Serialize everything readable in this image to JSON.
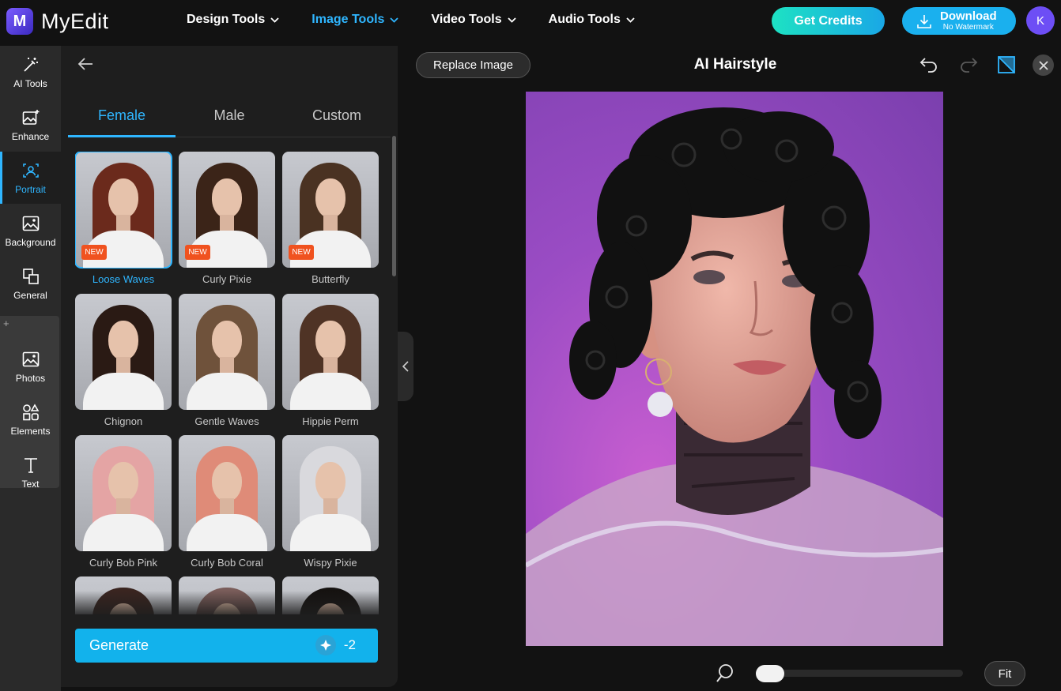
{
  "app": {
    "logo_letter": "M",
    "name": "MyEdit"
  },
  "nav": [
    {
      "label": "Design Tools"
    },
    {
      "label": "Image Tools"
    },
    {
      "label": "Video Tools"
    },
    {
      "label": "Audio Tools"
    }
  ],
  "header": {
    "credits_label": "Get Credits",
    "download_label": "Download",
    "download_sub": "No Watermark",
    "avatar_initial": "K"
  },
  "rail": [
    {
      "label": "AI Tools",
      "icon": "magic-wand-icon"
    },
    {
      "label": "Enhance",
      "icon": "enhance-image-icon"
    },
    {
      "label": "Portrait",
      "icon": "portrait-icon"
    },
    {
      "label": "Background",
      "icon": "background-icon"
    },
    {
      "label": "General",
      "icon": "general-icon"
    },
    {
      "label": "Photos",
      "icon": "photos-icon"
    },
    {
      "label": "Elements",
      "icon": "elements-icon"
    },
    {
      "label": "Text",
      "icon": "text-icon"
    }
  ],
  "tabs": [
    {
      "label": "Female"
    },
    {
      "label": "Male"
    },
    {
      "label": "Custom"
    }
  ],
  "styles": [
    {
      "label": "Loose Waves",
      "badge": "NEW",
      "hair": "#6b2a1c"
    },
    {
      "label": "Curly Pixie",
      "badge": "NEW",
      "hair": "#3b2418"
    },
    {
      "label": "Butterfly",
      "badge": "NEW",
      "hair": "#4a3222"
    },
    {
      "label": "Chignon",
      "badge": "",
      "hair": "#2a1a14"
    },
    {
      "label": "Gentle Waves",
      "badge": "",
      "hair": "#6f523b"
    },
    {
      "label": "Hippie Perm",
      "badge": "",
      "hair": "#4f3325"
    },
    {
      "label": "Curly Bob Pink",
      "badge": "",
      "hair": "#e4a4a4"
    },
    {
      "label": "Curly Bob Coral",
      "badge": "",
      "hair": "#df8b78"
    },
    {
      "label": "Wispy Pixie",
      "badge": "",
      "hair": "#d9d9dd"
    }
  ],
  "generate": {
    "label": "Generate",
    "cost": "-2"
  },
  "canvas": {
    "replace_label": "Replace Image",
    "title": "AI Hairstyle",
    "fit_label": "Fit"
  },
  "colors": {
    "accent": "#2fb6ff",
    "badge": "#f0521f",
    "generate": "#12b2ec"
  }
}
